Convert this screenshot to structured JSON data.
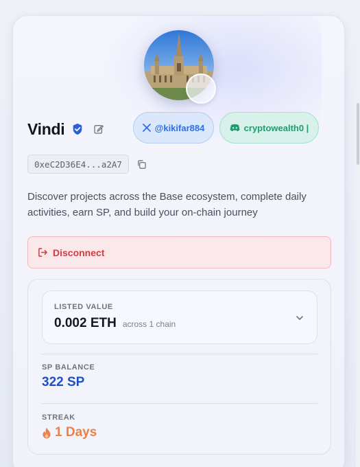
{
  "profile": {
    "name": "Vindi",
    "address": "0xeC2D36E4...a2A7",
    "description": "Discover projects across the Base ecosystem, complete daily activities, earn SP, and build your on-chain journey"
  },
  "socials": {
    "x_handle": "@kikifar884",
    "discord_handle": "cryptowealth0 |"
  },
  "actions": {
    "disconnect_label": "Disconnect"
  },
  "stats": {
    "listed_value_label": "LISTED VALUE",
    "listed_value": "0.002 ETH",
    "listed_value_sub": "across 1 chain",
    "sp_balance_label": "SP BALANCE",
    "sp_balance": "322 SP",
    "streak_label": "STREAK",
    "streak_value": "1 Days"
  },
  "colors": {
    "accent_blue": "#1d4fc9",
    "x_pill": "#2f6fe0",
    "discord_pill": "#1f9d6e",
    "danger": "#d43a45",
    "streak": "#e9824a"
  },
  "icons": {
    "verified": "verified-badge-icon",
    "edit": "edit-icon",
    "x": "x-logo-icon",
    "discord": "discord-icon",
    "copy": "copy-icon",
    "disconnect": "logout-icon",
    "chevron": "chevron-down-icon",
    "flame": "flame-icon"
  }
}
